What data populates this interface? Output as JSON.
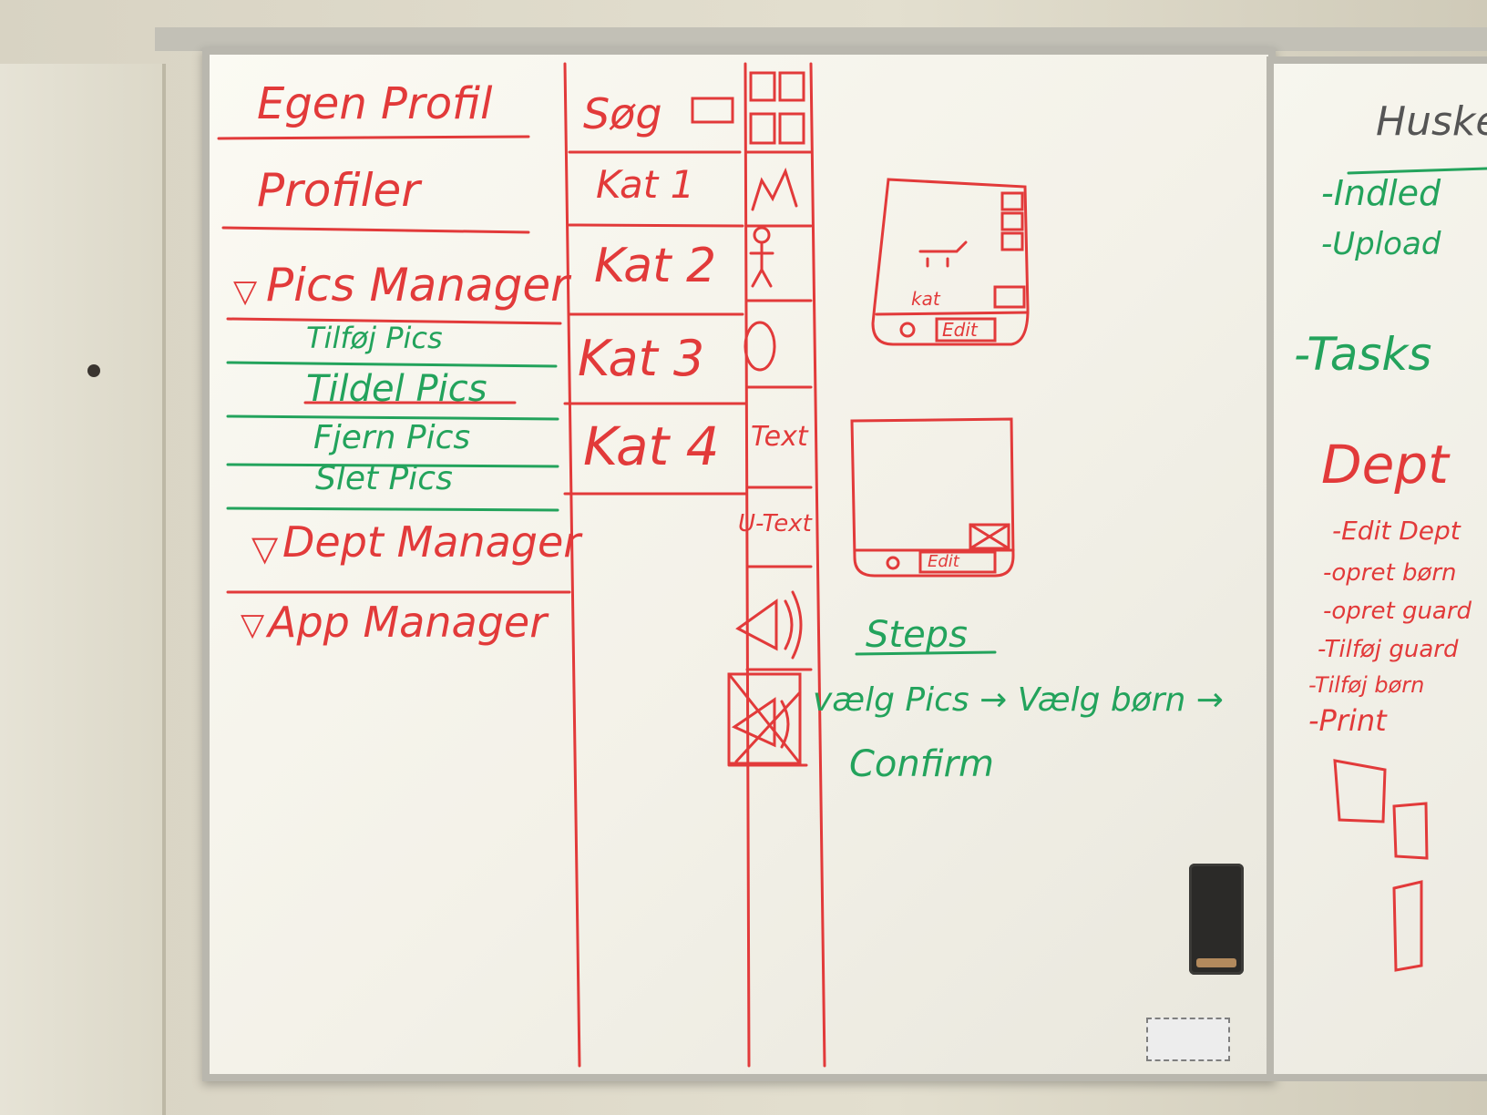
{
  "colors": {
    "red_marker": "#e23a3a",
    "green_marker": "#23a35c"
  },
  "sidebar": {
    "egen_profil": "Egen Profil",
    "profiler": "Profiler",
    "pics_manager": "Pics Manager",
    "pics_items": [
      "Tilføj Pics",
      "Tildel Pics",
      "Fjern Pics",
      "Slet Pics"
    ],
    "dept_manager": "Dept Manager",
    "app_manager": "App Manager"
  },
  "categories": {
    "search": "Søg",
    "items": [
      "Kat 1",
      "Kat 2",
      "Kat 3",
      "Kat 4"
    ]
  },
  "tools": {
    "text": "Text",
    "u_text": "U-Text"
  },
  "cards": {
    "card1_label": "kat",
    "edit": "Edit"
  },
  "steps": {
    "title": "Steps",
    "line1": "vælg Pics → Vælg børn →",
    "line2": "Confirm"
  },
  "board2": {
    "title": "Huskel",
    "green_items": [
      "-Indled",
      "-Upload"
    ],
    "tasks": "-Tasks",
    "dept": "Dept",
    "red_items": [
      "-Edit Dept",
      "-opret børn",
      "-opret guard",
      "-Tilføj guard",
      "-Tilføj børn",
      "-Print"
    ]
  }
}
